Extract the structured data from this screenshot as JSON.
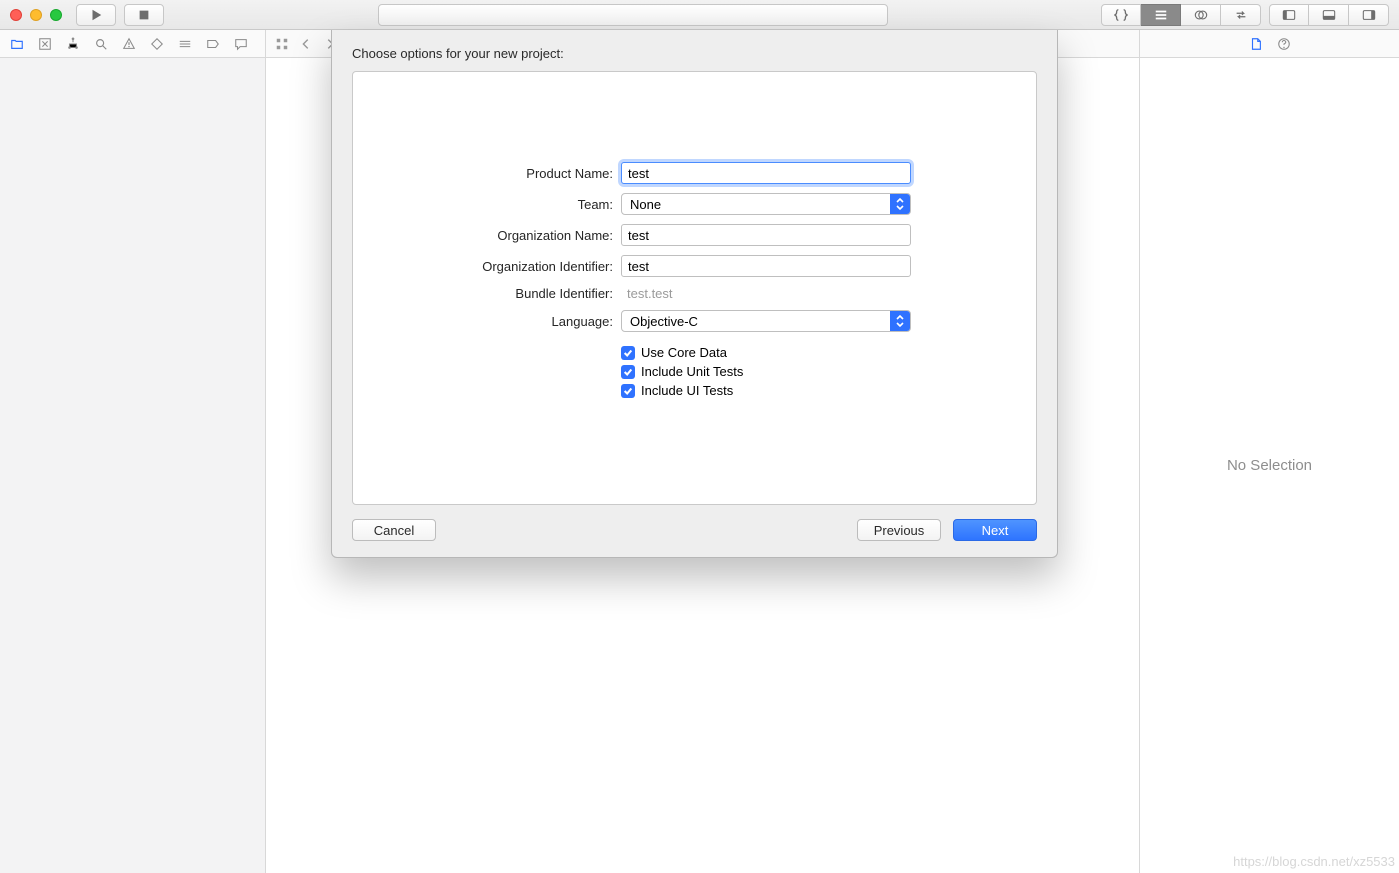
{
  "inspector": {
    "placeholder": "No Selection"
  },
  "sheet": {
    "title": "Choose options for your new project:",
    "labels": {
      "product_name": "Product Name:",
      "team": "Team:",
      "org_name": "Organization Name:",
      "org_id": "Organization Identifier:",
      "bundle_id": "Bundle Identifier:",
      "language": "Language:"
    },
    "values": {
      "product_name": "test",
      "team": "None",
      "org_name": "test",
      "org_id": "test",
      "bundle_id": "test.test",
      "language": "Objective-C"
    },
    "checks": {
      "core_data": "Use Core Data",
      "unit_tests": "Include Unit Tests",
      "ui_tests": "Include UI Tests"
    },
    "buttons": {
      "cancel": "Cancel",
      "previous": "Previous",
      "next": "Next"
    }
  },
  "watermark": "https://blog.csdn.net/xz5533"
}
